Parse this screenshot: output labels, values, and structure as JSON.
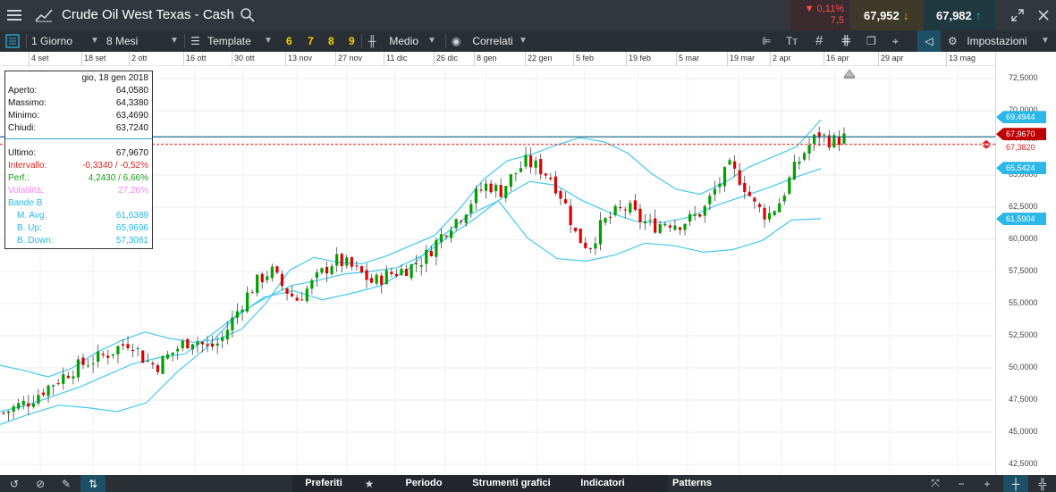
{
  "window": {
    "title": "Crude Oil West Texas - Cash",
    "change_pct": "▼ 0,11%",
    "change_abs": "7,5",
    "sell_price": "67,952",
    "buy_price": "67,982",
    "colors": {
      "titlebar": "#31373d",
      "toolbar": "#2a2f35",
      "down": "#ff4d4d",
      "accent": "#2aa7d6"
    }
  },
  "toolbar": {
    "interval": "1 Giorno",
    "range": "8 Mesi",
    "template": "Template",
    "presets": [
      "6",
      "7",
      "8",
      "9"
    ],
    "chart_type": "Medio",
    "related": "Correlati",
    "settings": "Impostazioni"
  },
  "date_axis": [
    "4 set",
    "18 set",
    "2 ott",
    "16 ott",
    "30 ott",
    "13 nov",
    "27 nov",
    "11 dic",
    "26 dic",
    "8 gen",
    "22 gen",
    "5 feb",
    "19 feb",
    "5 mar",
    "19 mar",
    "2 apr",
    "16 apr",
    "29 apr",
    "13 mag"
  ],
  "price_axis": [
    "72,5000",
    "70,0000",
    "67,5000",
    "65,0000",
    "62,5000",
    "60,0000",
    "57,5000",
    "55,0000",
    "52,5000",
    "50,0000",
    "47,5000",
    "45,0000",
    "42,5000"
  ],
  "price_tags": {
    "band_up": "69,4944",
    "last": "67,9670",
    "ref": "67,3820",
    "mid": "65,5424",
    "band_down": "61,5904"
  },
  "info": {
    "date": "gio, 18 gen 2018",
    "rows": [
      {
        "k": "Aperto:",
        "v": "64,0580"
      },
      {
        "k": "Massimo:",
        "v": "64,3380"
      },
      {
        "k": "Minimo:",
        "v": "63,4690"
      },
      {
        "k": "Chiudi:",
        "v": "63,7240"
      }
    ],
    "last_k": "Ultimo:",
    "last_v": "67,9670",
    "interval_k": "Intervallo:",
    "interval_v": "-0,3340 / -0,52%",
    "perf_k": "Perf.:",
    "perf_v": "4,2430 / 6,66%",
    "vol_k": "Volatilità:",
    "vol_v": "27,26%",
    "bands_title": "Bande B",
    "mavg_k": "M. Avg:",
    "mavg_v": "61,6389",
    "bup_k": "B. Up:",
    "bup_v": "65,9696",
    "bdown_k": "B. Down:",
    "bdown_v": "57,3081"
  },
  "bottom_bar": {
    "items": [
      "Preferiti",
      "Periodo",
      "Strumenti grafici",
      "Indicatori",
      "Patterns"
    ]
  },
  "chart_data": {
    "type": "candlestick",
    "instrument": "Crude Oil West Texas - Cash",
    "xlabel": "",
    "ylabel": "",
    "ylim": [
      42.5,
      73.5
    ],
    "grid": true,
    "x_ticks": [
      "4 set",
      "18 set",
      "2 ott",
      "16 ott",
      "30 ott",
      "13 nov",
      "27 nov",
      "11 dic",
      "26 dic",
      "8 gen",
      "22 gen",
      "5 feb",
      "19 feb",
      "5 mar",
      "19 mar",
      "2 apr",
      "16 apr",
      "29 apr",
      "13 mag"
    ],
    "close_path": [
      46.5,
      47.0,
      47.4,
      48.2,
      48.9,
      49.6,
      50.2,
      50.6,
      51.0,
      51.6,
      52.1,
      50.7,
      50.1,
      51.0,
      51.8,
      52.3,
      51.5,
      52.0,
      53.8,
      55.5,
      56.8,
      57.6,
      56.2,
      55.3,
      56.3,
      57.4,
      58.4,
      58.0,
      57.4,
      56.6,
      57.2,
      57.5,
      57.9,
      58.5,
      59.8,
      61.1,
      61.9,
      63.4,
      64.3,
      63.7,
      65.0,
      66.0,
      65.6,
      64.8,
      63.0,
      60.2,
      59.4,
      61.2,
      62.0,
      62.5,
      61.5,
      61.0,
      61.4,
      61.2,
      61.6,
      62.3,
      64.1,
      65.6,
      64.5,
      62.6,
      61.8,
      63.0,
      65.3,
      67.0,
      68.2,
      67.6,
      67.9
    ],
    "bollinger_upper": [
      50.2,
      49.8,
      49.3,
      50.0,
      51.2,
      52.1,
      52.8,
      52.3,
      52.0,
      52.2,
      53.0,
      55.0,
      57.6,
      58.6,
      58.2,
      58.1,
      58.7,
      59.5,
      60.3,
      62.3,
      64.6,
      66.1,
      66.6,
      67.3,
      67.9,
      67.6,
      66.7,
      65.1,
      63.9,
      63.5,
      64.4,
      65.6,
      66.4,
      67.2,
      69.3
    ],
    "bollinger_mid": [
      46.6,
      47.1,
      47.8,
      48.5,
      49.4,
      50.3,
      50.8,
      51.1,
      52.6,
      54.2,
      55.4,
      56.4,
      56.8,
      57.3,
      57.5,
      57.8,
      58.8,
      60.3,
      61.7,
      63.3,
      64.5,
      64.2,
      63.0,
      62.1,
      61.4,
      61.3,
      61.7,
      62.6,
      63.3,
      64.0,
      64.8,
      65.5
    ],
    "bollinger_lower": [
      45.6,
      46.4,
      47.1,
      46.9,
      46.6,
      47.3,
      49.6,
      51.5,
      53.9,
      55.5,
      56.0,
      55.3,
      55.8,
      56.4,
      57.8,
      60.1,
      61.9,
      63.0,
      60.1,
      58.5,
      58.3,
      58.8,
      59.7,
      59.5,
      59.0,
      59.2,
      59.9,
      61.5,
      61.6
    ]
  }
}
